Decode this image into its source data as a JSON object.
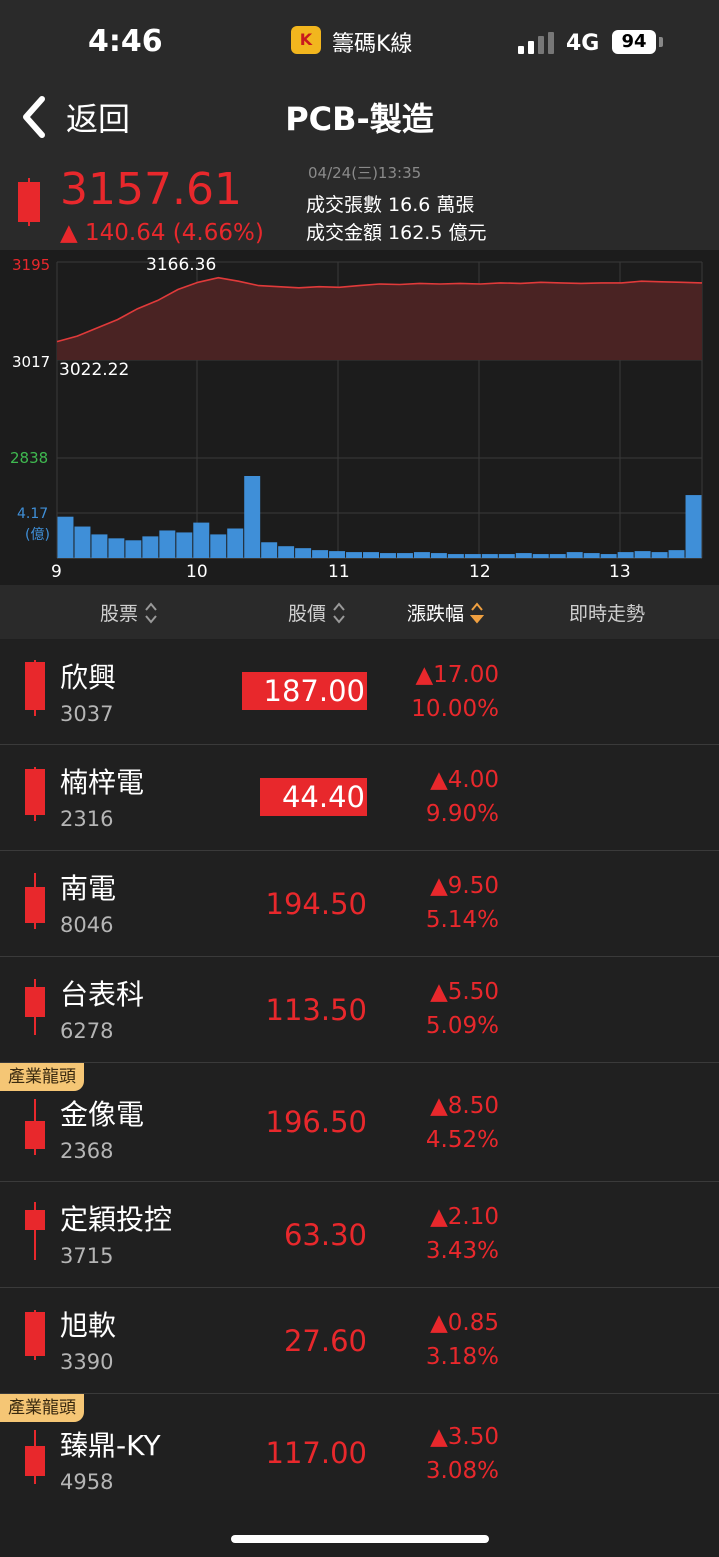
{
  "status_bar": {
    "time": "4:46",
    "app_name": "籌碼K線",
    "app_icon_letter": "K",
    "network": "4G",
    "battery": "94"
  },
  "nav": {
    "back_label": "返回",
    "title": "PCB-製造"
  },
  "summary": {
    "value": "3157.61",
    "change": "▲ 140.64 (4.66%)",
    "datetime": "04/24(三)13:35",
    "volume": "成交張數  16.6 萬張",
    "amount": "成交金額  162.5 億元"
  },
  "chart_data": {
    "type": "area",
    "y_axis_labels": {
      "high": "3195",
      "mid": "3017",
      "low": "2838"
    },
    "annotations": {
      "max": "3166.36",
      "min": "3022.22"
    },
    "volume_label": "4.17",
    "volume_unit": "(億)",
    "x_tick_labels": [
      "9",
      "10",
      "11",
      "12",
      "13"
    ],
    "ylim": [
      2838,
      3195
    ],
    "price_series": [
      3050,
      3060,
      3075,
      3090,
      3110,
      3125,
      3145,
      3158,
      3166.36,
      3160,
      3152,
      3150,
      3148,
      3150,
      3149,
      3152,
      3155,
      3154,
      3156,
      3155,
      3156,
      3155,
      3157,
      3156,
      3158,
      3157,
      3156,
      3157,
      3157,
      3160,
      3159,
      3158,
      3157
    ],
    "volume_series": [
      2.1,
      1.6,
      1.2,
      1.0,
      0.9,
      1.1,
      1.4,
      1.3,
      1.8,
      1.2,
      1.5,
      4.17,
      0.8,
      0.6,
      0.5,
      0.4,
      0.35,
      0.3,
      0.3,
      0.25,
      0.25,
      0.3,
      0.25,
      0.2,
      0.2,
      0.2,
      0.2,
      0.25,
      0.2,
      0.2,
      0.3,
      0.25,
      0.2,
      0.3,
      0.35,
      0.3,
      0.4,
      3.2
    ],
    "colors": {
      "line": "#e03a3a",
      "fill": "#4a2323",
      "volume": "#3f8fd8",
      "up": "#e8282c",
      "low_label": "#3fb950"
    }
  },
  "table_header": {
    "stock": "股票",
    "price": "股價",
    "change": "漲跌幅",
    "trend": "即時走勢"
  },
  "badge_label": "產業龍頭",
  "rows": [
    {
      "name": "欣興",
      "code": "3037",
      "price": "187.00",
      "change": "▲17.00",
      "pct": "10.00%"
    },
    {
      "name": "楠梓電",
      "code": "2316",
      "price": "44.40",
      "change": "▲4.00",
      "pct": "9.90%"
    },
    {
      "name": "南電",
      "code": "8046",
      "price": "194.50",
      "change": "▲9.50",
      "pct": "5.14%"
    },
    {
      "name": "台表科",
      "code": "6278",
      "price": "113.50",
      "change": "▲5.50",
      "pct": "5.09%"
    },
    {
      "name": "金像電",
      "code": "2368",
      "price": "196.50",
      "change": "▲8.50",
      "pct": "4.52%"
    },
    {
      "name": "定穎投控",
      "code": "3715",
      "price": "63.30",
      "change": "▲2.10",
      "pct": "3.43%"
    },
    {
      "name": "旭軟",
      "code": "3390",
      "price": "27.60",
      "change": "▲0.85",
      "pct": "3.18%"
    },
    {
      "name": "臻鼎-KY",
      "code": "4958",
      "price": "117.00",
      "change": "▲3.50",
      "pct": "3.08%"
    }
  ]
}
